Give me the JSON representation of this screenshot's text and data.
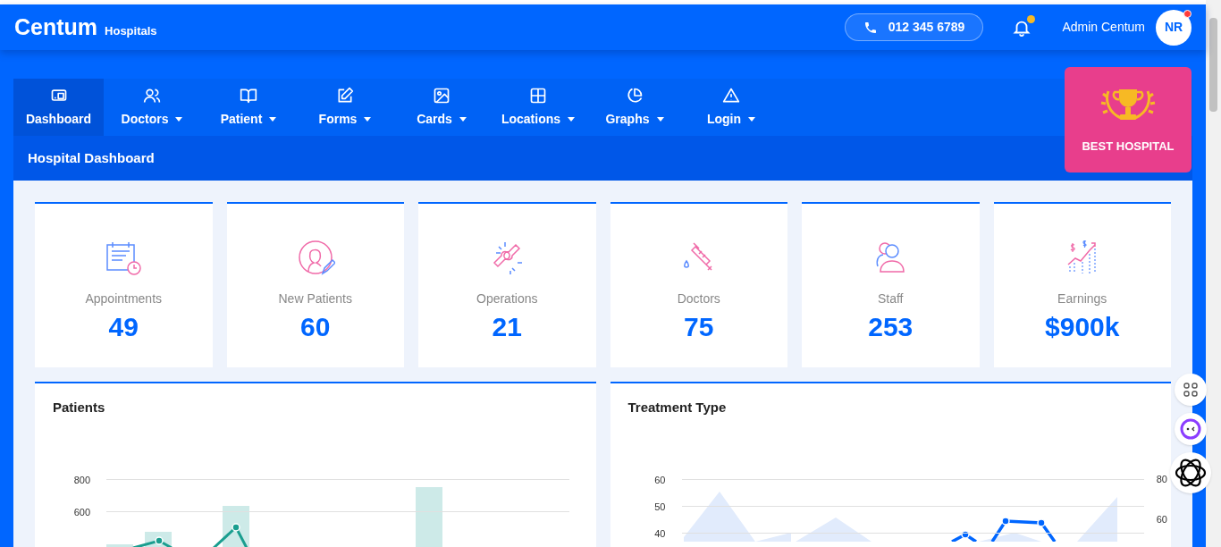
{
  "brand": {
    "name": "Centum",
    "sub": "Hospitals"
  },
  "header": {
    "phone": "012 345 6789",
    "notifications": true,
    "user": "Admin Centum",
    "avatar": "NR",
    "avatar_status": true
  },
  "nav": [
    {
      "label": "Dashboard",
      "dropdown": false,
      "selected": true
    },
    {
      "label": "Doctors",
      "dropdown": true,
      "selected": false
    },
    {
      "label": "Patient",
      "dropdown": true,
      "selected": false
    },
    {
      "label": "Forms",
      "dropdown": true,
      "selected": false
    },
    {
      "label": "Cards",
      "dropdown": true,
      "selected": false
    },
    {
      "label": "Locations",
      "dropdown": true,
      "selected": false
    },
    {
      "label": "Graphs",
      "dropdown": true,
      "selected": false
    },
    {
      "label": "Login",
      "dropdown": true,
      "selected": false
    }
  ],
  "page_title": "Hospital Dashboard",
  "award": {
    "label": "BEST HOSPITAL"
  },
  "stats": [
    {
      "label": "Appointments",
      "value": "49"
    },
    {
      "label": "New Patients",
      "value": "60"
    },
    {
      "label": "Operations",
      "value": "21"
    },
    {
      "label": "Doctors",
      "value": "75"
    },
    {
      "label": "Staff",
      "value": "253"
    },
    {
      "label": "Earnings",
      "value": "$900k"
    }
  ],
  "panels": [
    {
      "title": "Patients",
      "kind": "bars",
      "y_ticks": [
        "800",
        "600"
      ]
    },
    {
      "title": "Treatment Type",
      "kind": "area",
      "y_ticks": [
        "60",
        "50",
        "40"
      ],
      "y2_ticks": [
        "80",
        "60"
      ]
    }
  ]
}
